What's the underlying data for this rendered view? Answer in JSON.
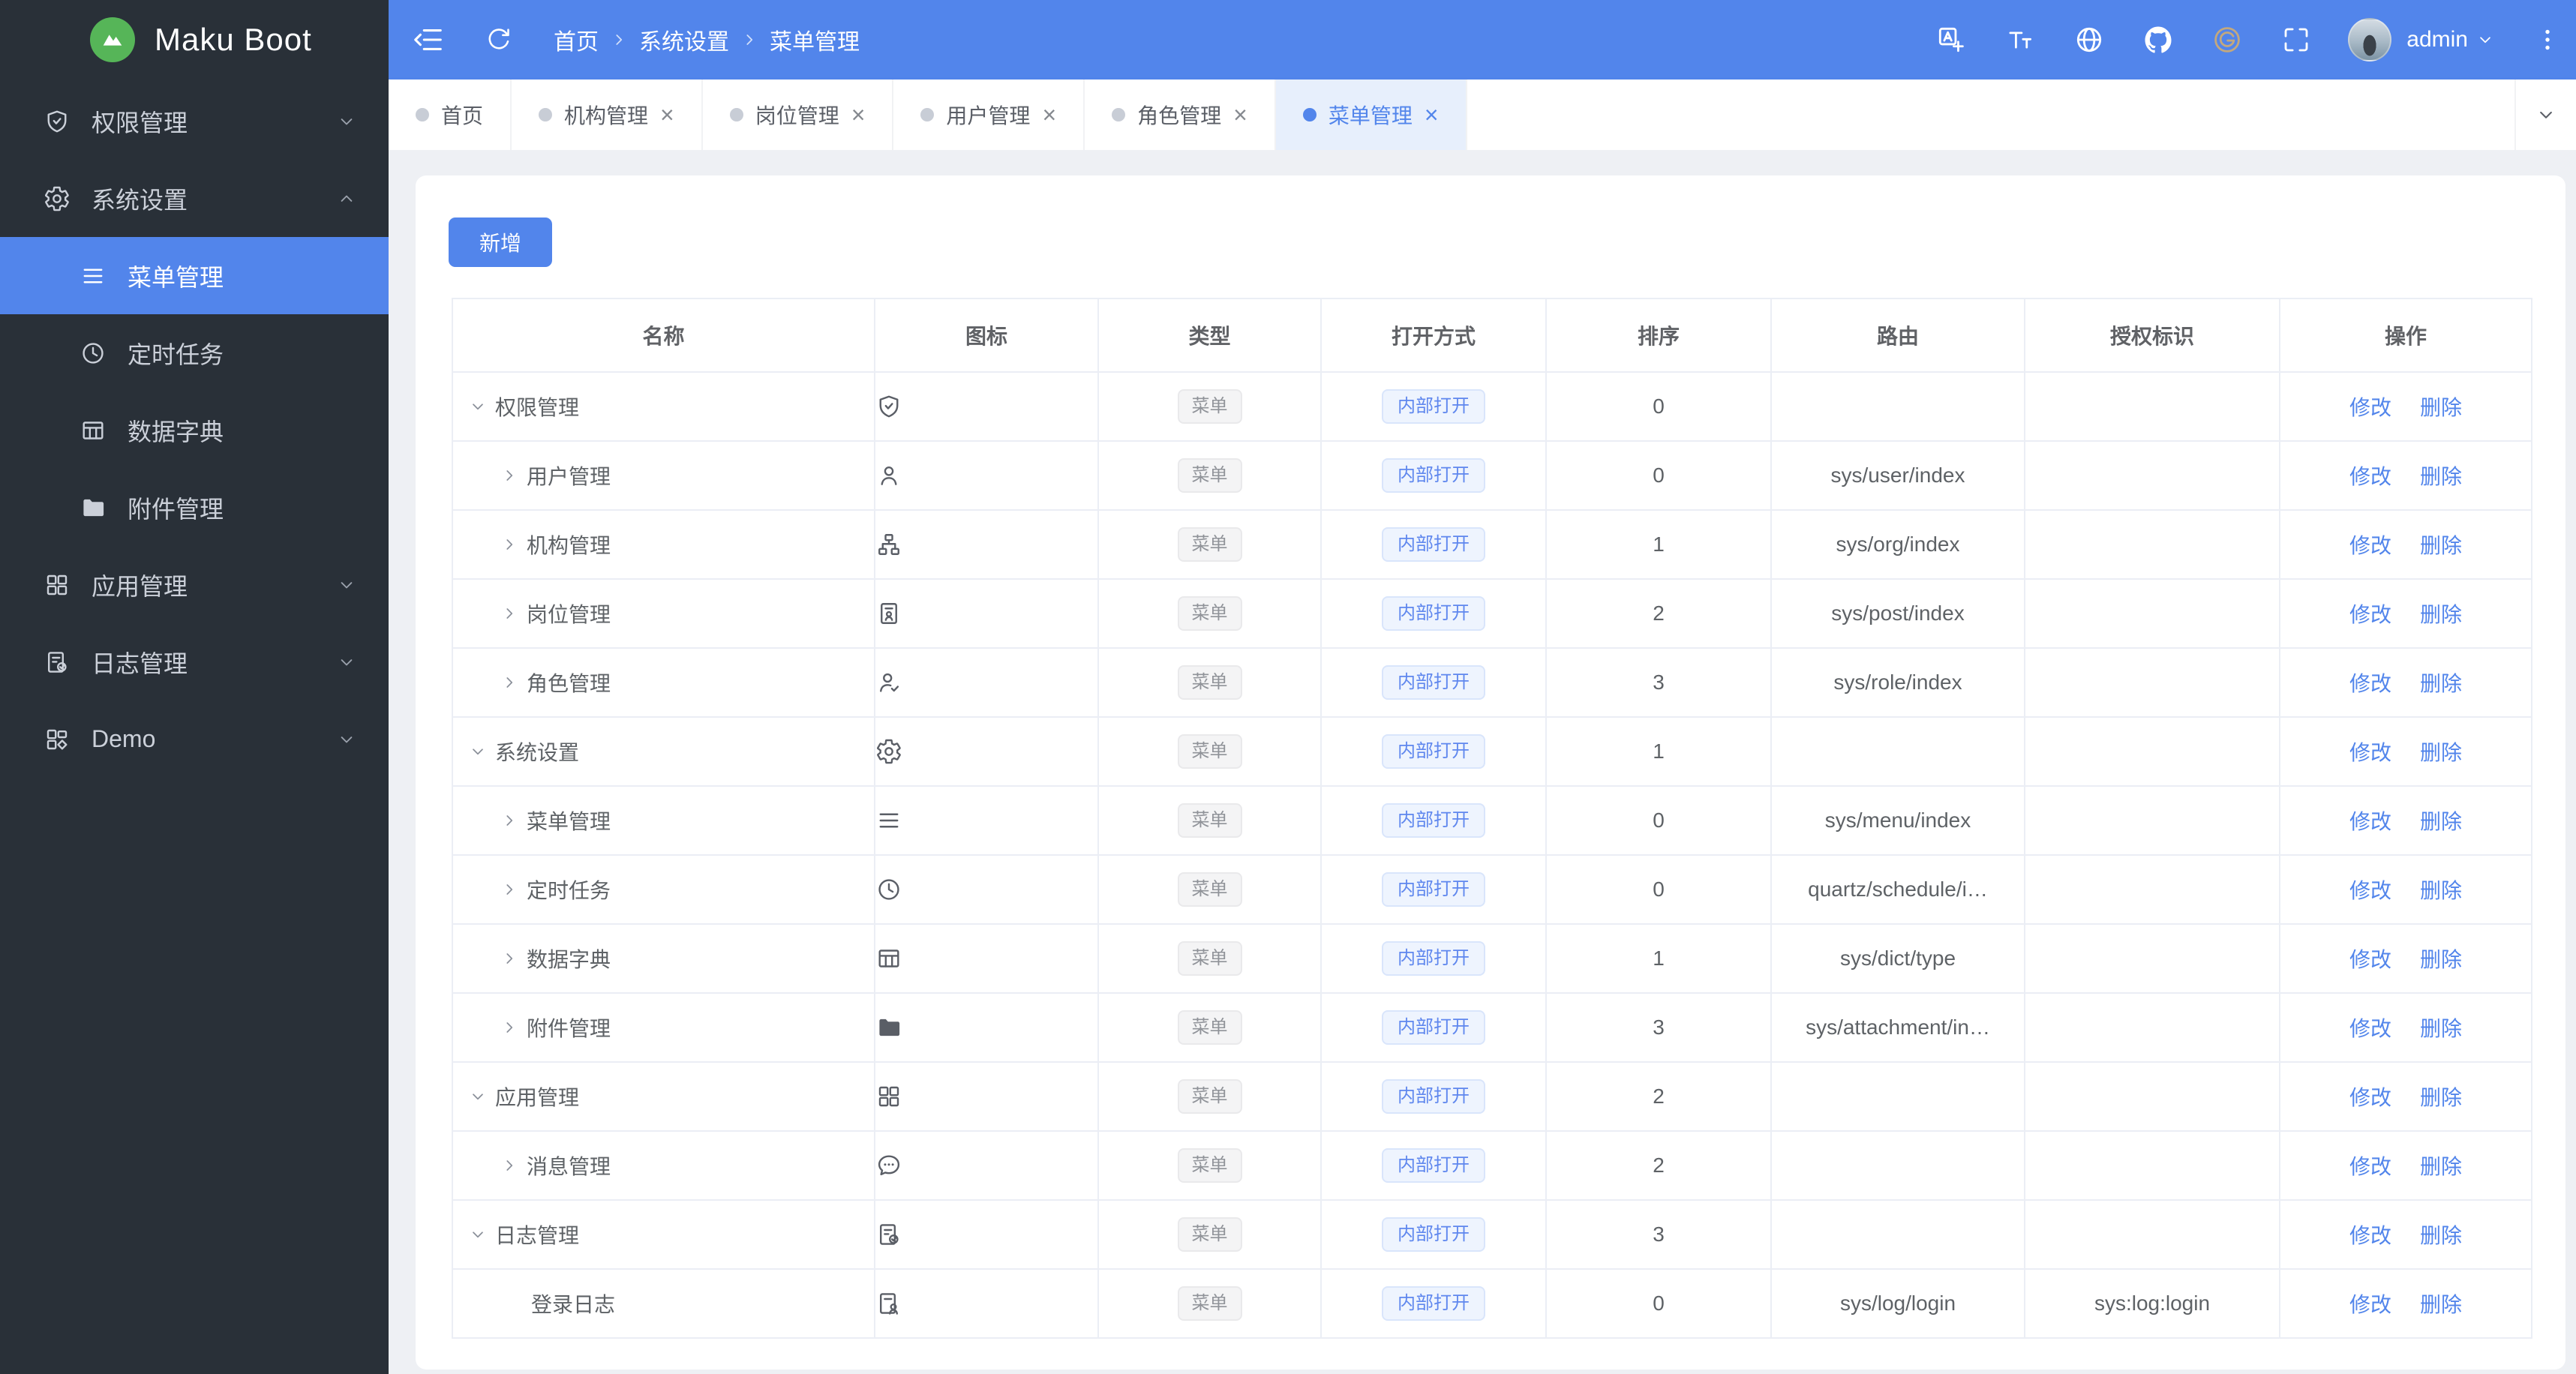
{
  "app": {
    "title": "Maku Boot"
  },
  "sidebar": {
    "groups": [
      {
        "label": "权限管理",
        "icon": "shield-check"
      },
      {
        "label": "系统设置",
        "icon": "gear",
        "expanded": true,
        "children": [
          {
            "label": "菜单管理",
            "icon": "menu-lines",
            "active": true
          },
          {
            "label": "定时任务",
            "icon": "clock"
          },
          {
            "label": "数据字典",
            "icon": "dict-table"
          },
          {
            "label": "附件管理",
            "icon": "folder"
          }
        ]
      },
      {
        "label": "应用管理",
        "icon": "app-grid"
      },
      {
        "label": "日志管理",
        "icon": "log-check"
      },
      {
        "label": "Demo",
        "icon": "demo-grid"
      }
    ]
  },
  "header": {
    "breadcrumb": [
      "首页",
      "系统设置",
      "菜单管理"
    ],
    "user": "admin",
    "icons": [
      "fold",
      "refresh",
      "translate",
      "font-size",
      "globe",
      "github",
      "gitee",
      "fullscreen",
      "more-dots"
    ]
  },
  "tabs": [
    {
      "label": "首页",
      "closable": false,
      "active": false
    },
    {
      "label": "机构管理",
      "closable": true,
      "active": false
    },
    {
      "label": "岗位管理",
      "closable": true,
      "active": false
    },
    {
      "label": "用户管理",
      "closable": true,
      "active": false
    },
    {
      "label": "角色管理",
      "closable": true,
      "active": false
    },
    {
      "label": "菜单管理",
      "closable": true,
      "active": true
    }
  ],
  "icons": {
    "close": "×"
  },
  "toolbar": {
    "add_label": "新增"
  },
  "table": {
    "columns": [
      "名称",
      "图标",
      "类型",
      "打开方式",
      "排序",
      "路由",
      "授权标识",
      "操作"
    ],
    "edit_label": "修改",
    "delete_label": "删除",
    "rows": [
      {
        "name": "权限管理",
        "icon": "shield-check",
        "type": "菜单",
        "open": "内部打开",
        "sort": "0",
        "route": "",
        "auth": ""
      },
      {
        "name": "用户管理",
        "icon": "user",
        "type": "菜单",
        "open": "内部打开",
        "sort": "0",
        "route": "sys/user/index",
        "auth": ""
      },
      {
        "name": "机构管理",
        "icon": "org-tree",
        "type": "菜单",
        "open": "内部打开",
        "sort": "1",
        "route": "sys/org/index",
        "auth": ""
      },
      {
        "name": "岗位管理",
        "icon": "id-badge",
        "type": "菜单",
        "open": "内部打开",
        "sort": "2",
        "route": "sys/post/index",
        "auth": ""
      },
      {
        "name": "角色管理",
        "icon": "user-check",
        "type": "菜单",
        "open": "内部打开",
        "sort": "3",
        "route": "sys/role/index",
        "auth": ""
      },
      {
        "name": "系统设置",
        "icon": "gear",
        "type": "菜单",
        "open": "内部打开",
        "sort": "1",
        "route": "",
        "auth": ""
      },
      {
        "name": "菜单管理",
        "icon": "menu-lines",
        "type": "菜单",
        "open": "内部打开",
        "sort": "0",
        "route": "sys/menu/index",
        "auth": ""
      },
      {
        "name": "定时任务",
        "icon": "clock",
        "type": "菜单",
        "open": "内部打开",
        "sort": "0",
        "route": "quartz/schedule/i…",
        "auth": ""
      },
      {
        "name": "数据字典",
        "icon": "dict-table",
        "type": "菜单",
        "open": "内部打开",
        "sort": "1",
        "route": "sys/dict/type",
        "auth": ""
      },
      {
        "name": "附件管理",
        "icon": "folder",
        "type": "菜单",
        "open": "内部打开",
        "sort": "3",
        "route": "sys/attachment/in…",
        "auth": ""
      },
      {
        "name": "应用管理",
        "icon": "app-grid",
        "type": "菜单",
        "open": "内部打开",
        "sort": "2",
        "route": "",
        "auth": ""
      },
      {
        "name": "消息管理",
        "icon": "chat-bubble",
        "type": "菜单",
        "open": "内部打开",
        "sort": "2",
        "route": "",
        "auth": ""
      },
      {
        "name": "日志管理",
        "icon": "log-check",
        "type": "菜单",
        "open": "内部打开",
        "sort": "3",
        "route": "",
        "auth": ""
      },
      {
        "name": "登录日志",
        "icon": "log-user",
        "type": "菜单",
        "open": "内部打开",
        "sort": "0",
        "route": "sys/log/login",
        "auth": "sys:log:login"
      }
    ]
  }
}
